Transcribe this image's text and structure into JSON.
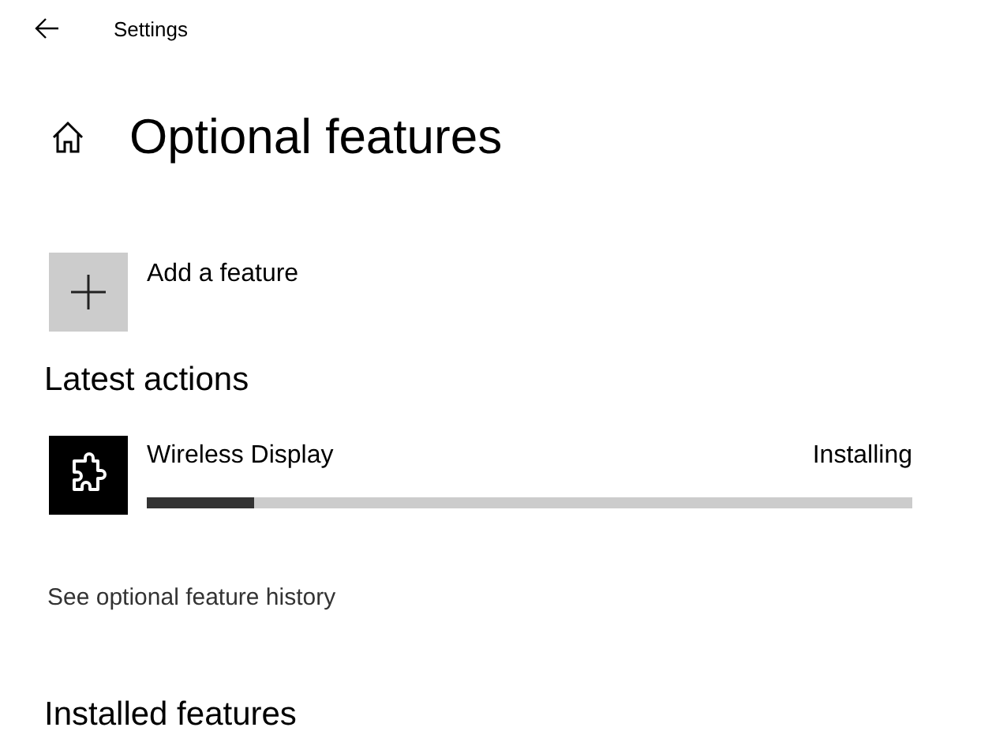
{
  "window": {
    "title": "Settings"
  },
  "page": {
    "title": "Optional features"
  },
  "add_feature": {
    "label": "Add a feature"
  },
  "latest_actions": {
    "heading": "Latest actions",
    "items": [
      {
        "name": "Wireless Display",
        "status": "Installing",
        "level": 0.14
      }
    ]
  },
  "history_link": "See optional feature history",
  "installed_features": {
    "heading": "Installed features"
  }
}
